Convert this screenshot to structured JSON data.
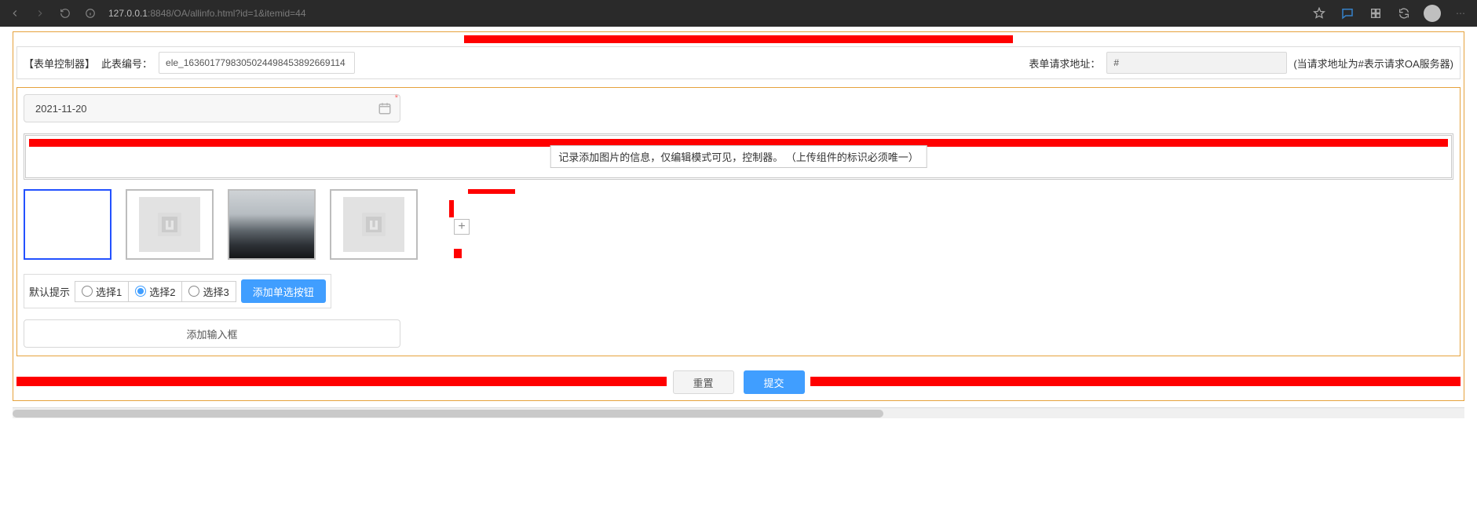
{
  "browser": {
    "url_prefix": "127.0.0.1",
    "url_rest": ":8848/OA/allinfo.html?id=1&itemid=44"
  },
  "form_controller": {
    "title": "【表单控制器】",
    "id_label": "此表编号：",
    "id_value": "ele_16360177983050244984538926691​14",
    "url_label": "表单请求地址：",
    "url_value": "#",
    "hint": "(当请求地址为#表示请求OA服务器)"
  },
  "date": {
    "value": "2021-11-20"
  },
  "uploader": {
    "info": "记录添加图片的信息，仅编辑模式可见，控制器。 （上传组件的标识必须唯一）",
    "plus": "+"
  },
  "radios": {
    "hint": "默认提示",
    "options": [
      {
        "label": "选择1",
        "selected": false
      },
      {
        "label": "选择2",
        "selected": true
      },
      {
        "label": "选择3",
        "selected": false
      }
    ],
    "add_btn": "添加单选按钮"
  },
  "add_input_label": "添加输入框",
  "footer": {
    "reset": "重置",
    "submit": "提交"
  }
}
